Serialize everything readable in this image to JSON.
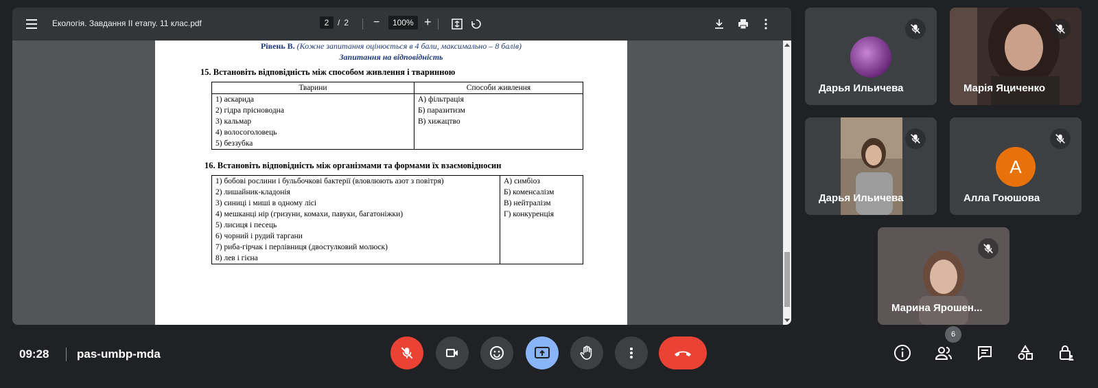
{
  "pdf": {
    "title": "Екологія. Завдання ІІ етапу. 11 клас.pdf",
    "page_current": "2",
    "page_sep": "/",
    "page_total": "2",
    "zoom": "100%"
  },
  "document": {
    "level_title": "Рівень В.",
    "level_note": "(Кожне запитання оцінюється в 4 бали, максимально – 8 балів)",
    "section_title": "Запитання на відповідність",
    "q15": {
      "title": "15. Встановіть відповідність між способом живлення і тваринною",
      "headers": [
        "Тварини",
        "Способи живлення"
      ],
      "left": [
        "1) аскарида",
        "2) гідра прісноводна",
        "3) кальмар",
        "4) волосоголовець",
        "5) беззубка"
      ],
      "right": [
        "А) фільтрація",
        "Б) паразитизм",
        "В) хижацтво"
      ]
    },
    "q16": {
      "title": "16. Встановіть відповідність між організмами та формами їх взаємовідносин",
      "left": [
        "1) бобові рослини і бульбочкові бактерії (вловлюють азот з повітря)",
        "2) лишайник-кладонія",
        "3) синиці і миші в одному лісі",
        "4) мешканці нір (гризуни, комахи, павуки, багатоніжки)",
        "5) лисиця і песець",
        "6) чорний і рудий таргани",
        "7) риба-гірчак і перлівниця (двостулковий молюск)",
        "8) лев і гієна"
      ],
      "right": [
        "А) симбіоз",
        "Б) коменсалізм",
        "В) нейтралізм",
        "Г) конкуренція"
      ]
    }
  },
  "participants": [
    {
      "name": "Дарья Ильичева",
      "muted": true,
      "avatar": "photo-circle"
    },
    {
      "name": "Марія Яциченко",
      "muted": true,
      "avatar": "video"
    },
    {
      "name": "Дарья Ильичева",
      "muted": true,
      "avatar": "video"
    },
    {
      "name": "Алла Гоюшова",
      "muted": true,
      "avatar": "letter",
      "initial": "A",
      "color": "#e8710a"
    },
    {
      "name": "Марина Ярошен...",
      "muted": true,
      "avatar": "video"
    }
  ],
  "bottom_bar": {
    "time": "09:28",
    "meeting_code": "pas-umbp-mda",
    "people_count": "6"
  },
  "colors": {
    "background": "#202124",
    "tile": "#3c4043",
    "danger": "#ea4335",
    "present_active": "#8ab4f8"
  }
}
